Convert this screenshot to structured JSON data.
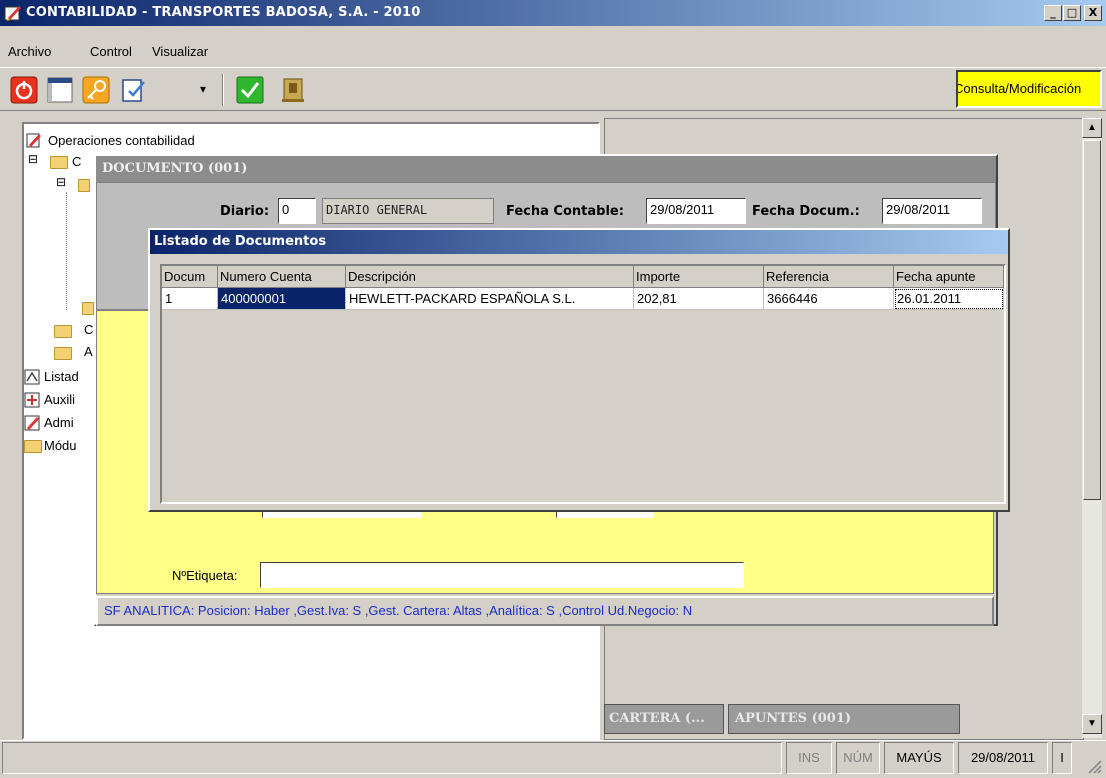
{
  "window": {
    "title": "CONTABILIDAD - TRANSPORTES BADOSA, S.A. - 2010",
    "btn_min": "_",
    "btn_max": "□",
    "btn_close": "X"
  },
  "menu": [
    "Archivo",
    "Control",
    "Visualizar"
  ],
  "toolbar": {
    "mode_label": "Consulta/Modificación",
    "dropdown_arrow": "▾"
  },
  "tree": {
    "root": "Operaciones contabilidad",
    "items": [
      "C",
      "C",
      "A",
      "Listad",
      "Auxili",
      "Admi",
      "Módu"
    ],
    "expand": "⊟"
  },
  "tabs": {
    "cartera": "CARTERA (...",
    "apuntes": "APUNTES (001)"
  },
  "documento": {
    "title": "DOCUMENTO (001)",
    "diario_label": "Diario:",
    "diario_value": "0",
    "diario_name": "DIARIO GENERAL",
    "fecha_contable_label": "Fecha Contable:",
    "fecha_contable_value": "29/08/2011",
    "fecha_docum_label": "Fecha Docum.:",
    "fecha_docum_value": "29/08/2011",
    "etiqueta_label": "NºEtiqueta:",
    "etiqueta_value": "",
    "status": "SF ANALITICA: Posicion: Haber ,Gest.Iva: S ,Gest. Cartera: Altas ,Analítica: S ,Control Ud.Negocio: N"
  },
  "listado": {
    "title": "Listado de Documentos",
    "columns": [
      "Docum",
      "Numero Cuenta",
      "Descripción",
      "Importe",
      "Referencia",
      "Fecha apunte"
    ],
    "rows": [
      [
        "1",
        "400000001",
        "HEWLETT-PACKARD ESPAÑOLA S.L.",
        "202,81",
        "3666446",
        "26.01.2011"
      ]
    ]
  },
  "scroll": {
    "up": "▲",
    "down": "▼"
  },
  "statusbar": {
    "ins": "INS",
    "num": "NÚM",
    "mayus": "MAYÚS",
    "date": "29/08/2011",
    "extra": "I"
  },
  "colors": {
    "title_gradient_start": "#0a246a",
    "mode_bg": "#ffff00",
    "panel_yellow": "#ffff88",
    "status_text": "#1a2cc8",
    "selected_row": "#0a246a"
  }
}
